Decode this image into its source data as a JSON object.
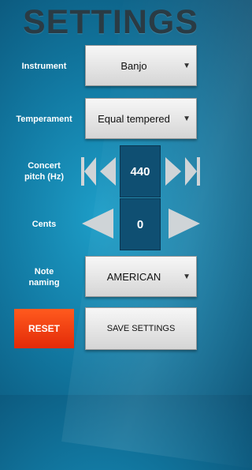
{
  "title": "SETTINGS",
  "instrument": {
    "label": "Instrument",
    "value": "Banjo"
  },
  "temperament": {
    "label": "Temperament",
    "value": "Equal tempered"
  },
  "concert_pitch": {
    "label_line1": "Concert",
    "label_line2": "pitch (Hz)",
    "value": "440"
  },
  "cents": {
    "label": "Cents",
    "value": "0"
  },
  "note_naming": {
    "label_line1": "Note",
    "label_line2": "naming",
    "value": "AMERICAN"
  },
  "buttons": {
    "reset": "RESET",
    "save": "SAVE SETTINGS"
  },
  "dropdown_arrow": "▼",
  "colors": {
    "background": "#127aa3",
    "title": "#2a3b44",
    "value_box": "#0f4f72",
    "reset": "#e32a08"
  },
  "icons": [
    "first-icon",
    "prev-icon",
    "next-icon",
    "last-icon",
    "decrement-icon",
    "increment-icon"
  ]
}
